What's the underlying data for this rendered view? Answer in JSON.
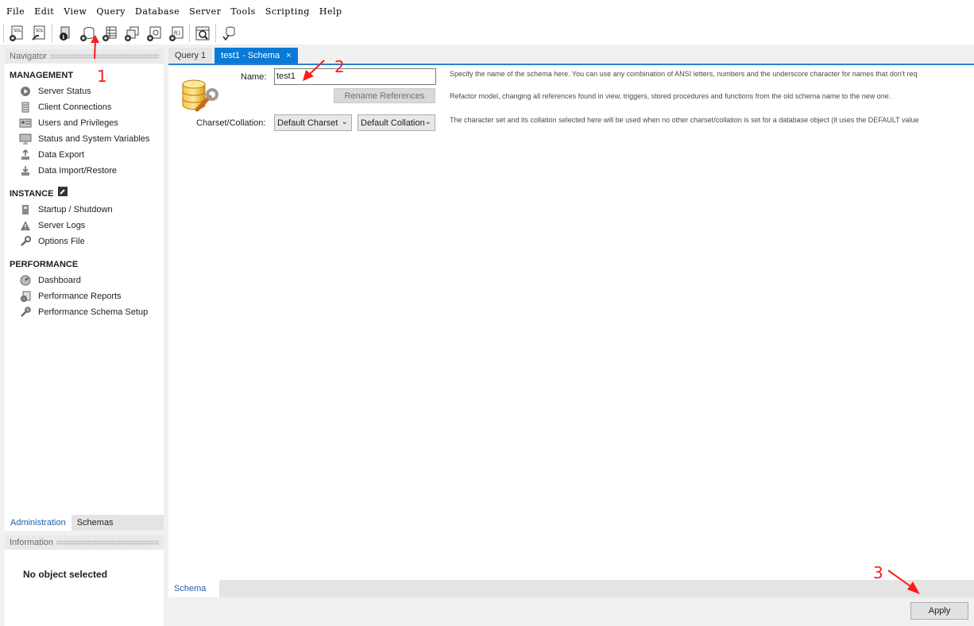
{
  "menu": [
    "File",
    "Edit",
    "View",
    "Query",
    "Database",
    "Server",
    "Tools",
    "Scripting",
    "Help"
  ],
  "toolbar_icons": [
    "new-sql-tab-icon",
    "open-sql-script-icon",
    "inspector-icon",
    "create-schema-icon",
    "create-table-icon",
    "create-view-icon",
    "create-procedure-icon",
    "create-function-icon",
    "search-table-data-icon",
    "reconnect-icon"
  ],
  "navigator": {
    "header": "Navigator",
    "management": {
      "title": "MANAGEMENT",
      "items": [
        "Server Status",
        "Client Connections",
        "Users and Privileges",
        "Status and System Variables",
        "Data Export",
        "Data Import/Restore"
      ]
    },
    "instance": {
      "title": "INSTANCE",
      "items": [
        "Startup / Shutdown",
        "Server Logs",
        "Options File"
      ]
    },
    "performance": {
      "title": "PERFORMANCE",
      "items": [
        "Dashboard",
        "Performance Reports",
        "Performance Schema Setup"
      ]
    },
    "tabs": [
      "Administration",
      "Schemas"
    ]
  },
  "information": {
    "header": "Information",
    "text": "No object selected"
  },
  "tabs": [
    {
      "label": "Query 1"
    },
    {
      "label": "test1 - Schema",
      "close": "×"
    }
  ],
  "schema_editor": {
    "name_label": "Name:",
    "name_value": "test1",
    "rename_button": "Rename References",
    "charset_label": "Charset/Collation:",
    "charset_value": "Default Charset",
    "collation_value": "Default Collation",
    "hint_name": "Specify the name of the schema here. You can use any combination of ANSI letters, numbers and the underscore character for names that don't req",
    "hint_rename": "Refactor model, changing all references found in view, triggers, stored procedures and functions from the old schema name to the new one.",
    "hint_charset": "The character set and its collation selected here will be used when no other charset/collation is set for a database object (it uses the DEFAULT value"
  },
  "editor_tab": "Schema",
  "apply_button": "Apply",
  "annotations": [
    "1",
    "2",
    "3"
  ],
  "colors": {
    "accent": "#0a7ad6",
    "annotation": "#ff1a1a"
  }
}
